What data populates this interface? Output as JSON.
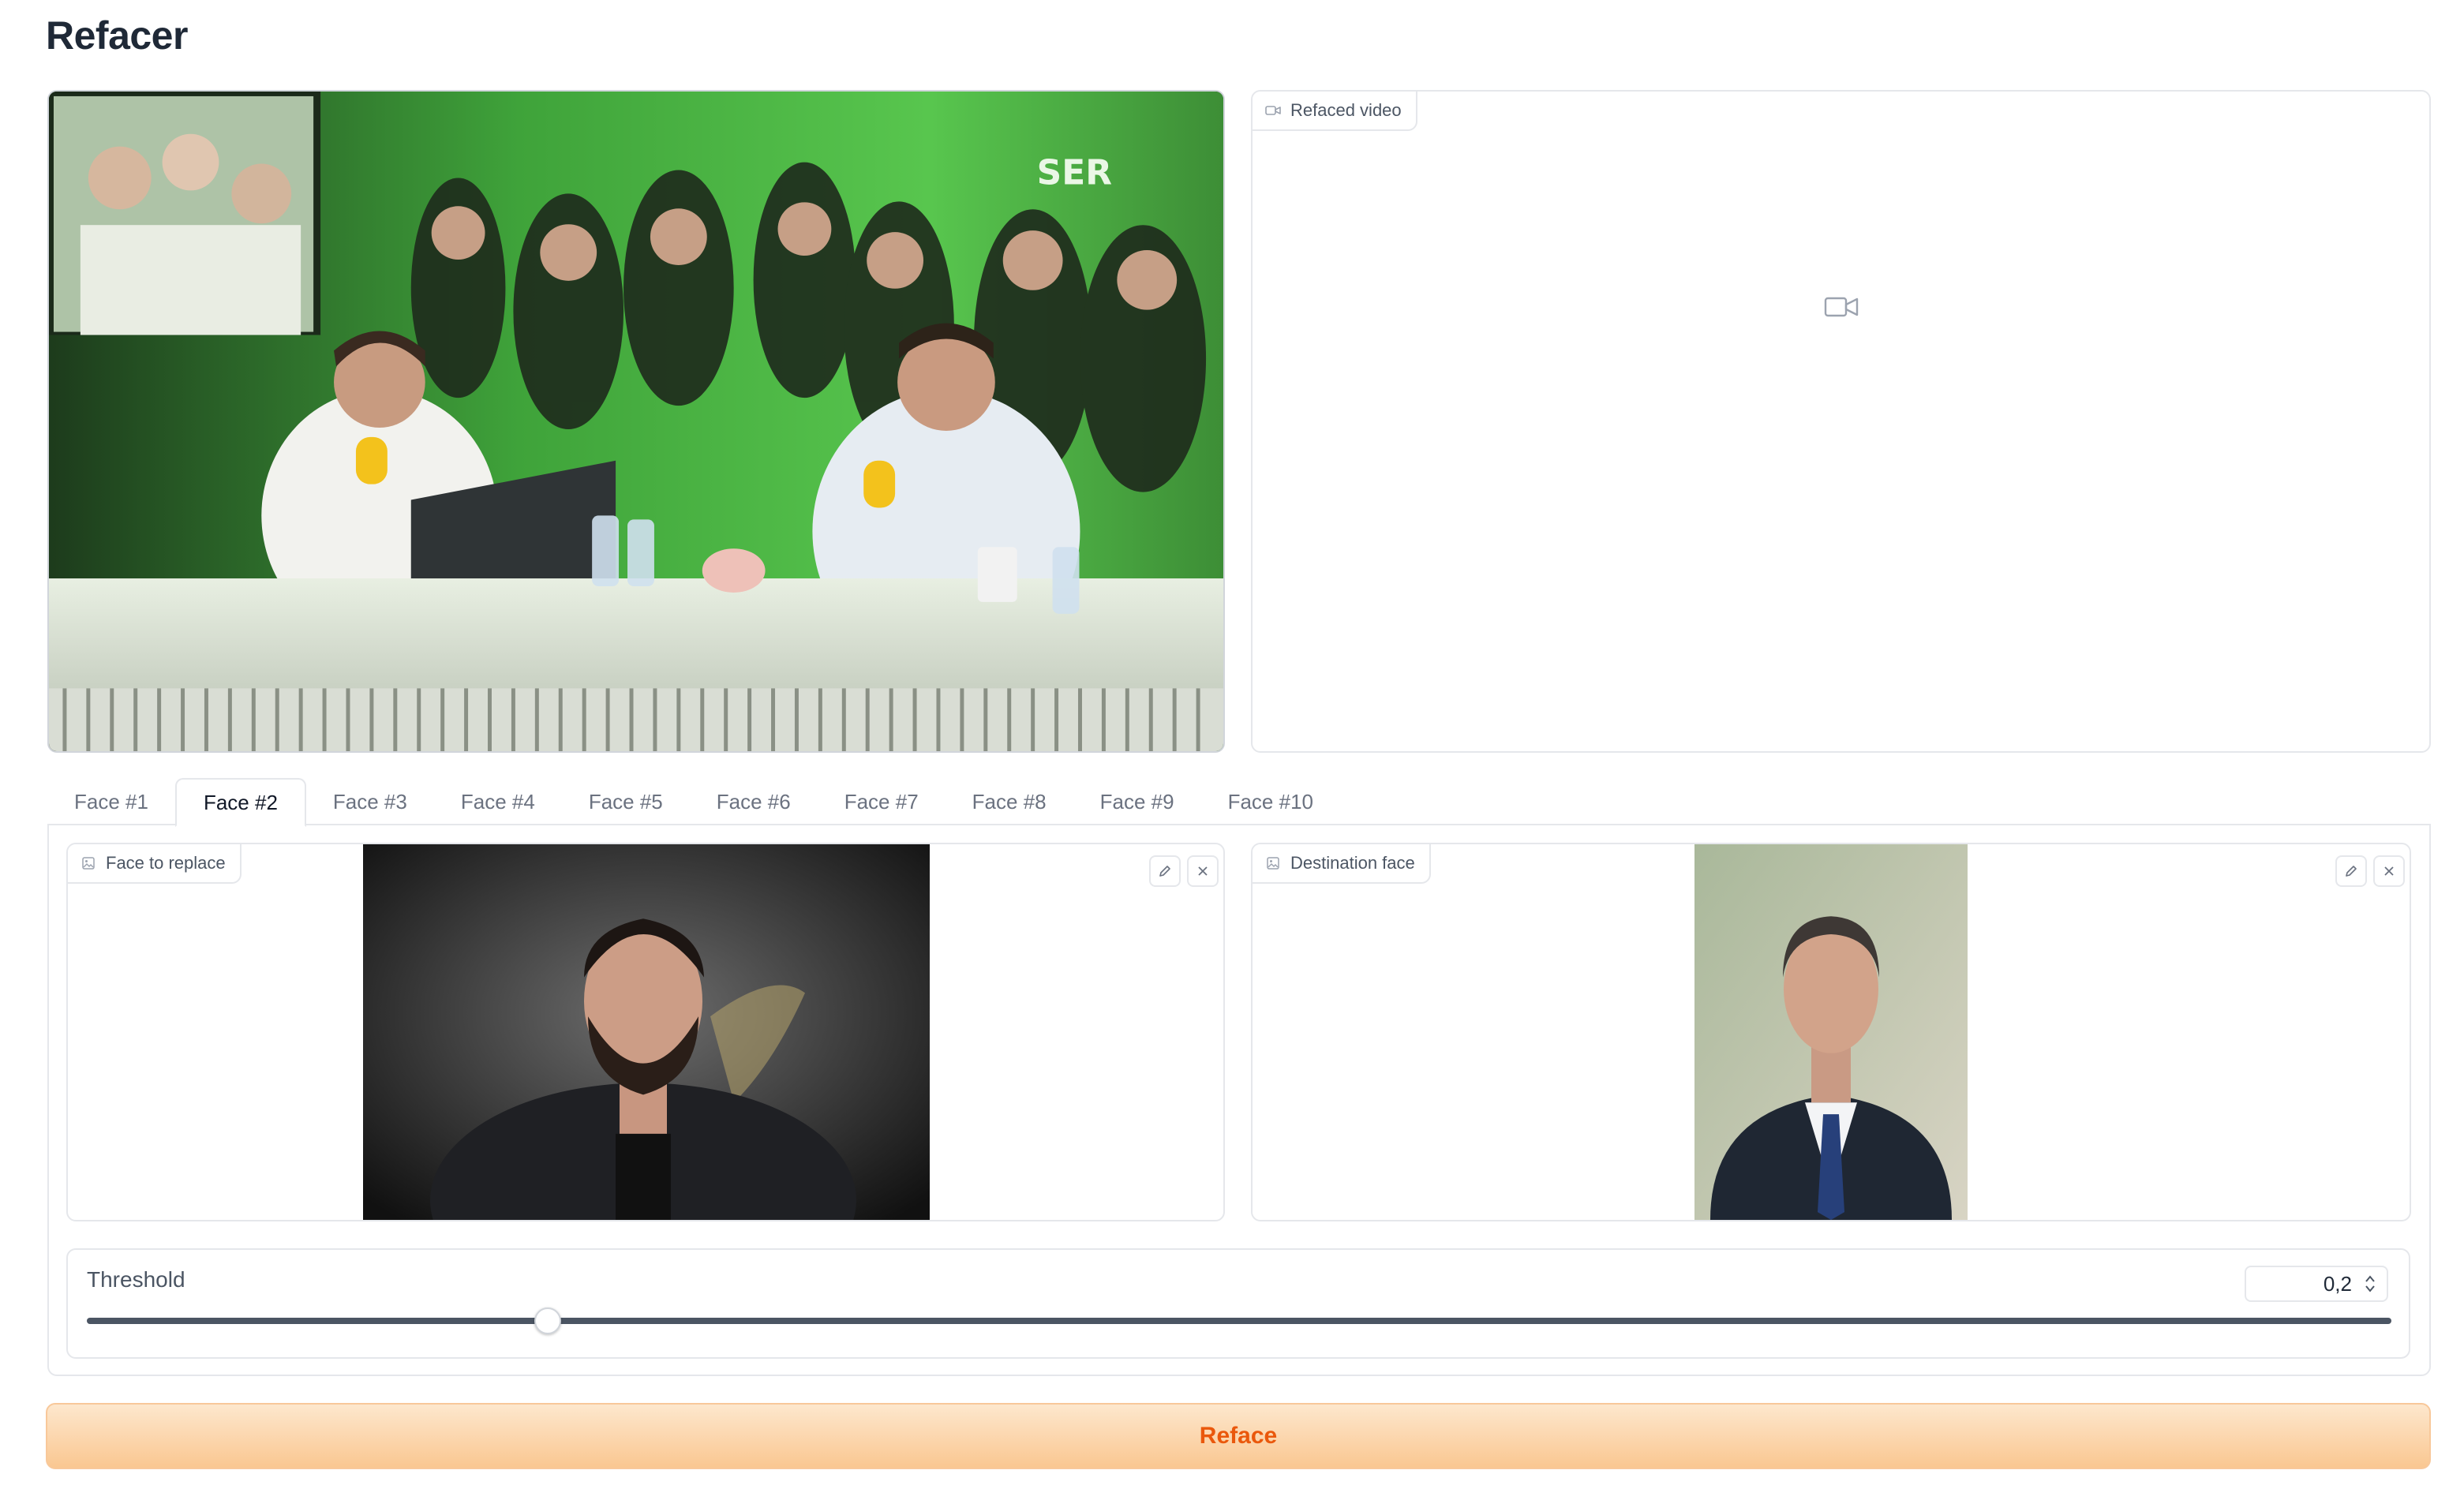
{
  "app": {
    "title": "Refacer"
  },
  "output_video": {
    "label": "Refaced video",
    "icon": "video-camera-icon"
  },
  "tabs": [
    {
      "label": "Face #1",
      "selected": false
    },
    {
      "label": "Face #2",
      "selected": true
    },
    {
      "label": "Face #3",
      "selected": false
    },
    {
      "label": "Face #4",
      "selected": false
    },
    {
      "label": "Face #5",
      "selected": false
    },
    {
      "label": "Face #6",
      "selected": false
    },
    {
      "label": "Face #7",
      "selected": false
    },
    {
      "label": "Face #8",
      "selected": false
    },
    {
      "label": "Face #9",
      "selected": false
    },
    {
      "label": "Face #10",
      "selected": false
    }
  ],
  "face_to_replace": {
    "label": "Face to replace",
    "icon": "image-icon"
  },
  "destination_face": {
    "label": "Destination face",
    "icon": "image-icon"
  },
  "threshold": {
    "label": "Threshold",
    "value": "0,2",
    "fraction": 0.2
  },
  "actions": {
    "reface_label": "Reface"
  },
  "colors": {
    "accent": "#ea580c",
    "button_bg": "#fac791",
    "border": "#e5e7eb"
  }
}
